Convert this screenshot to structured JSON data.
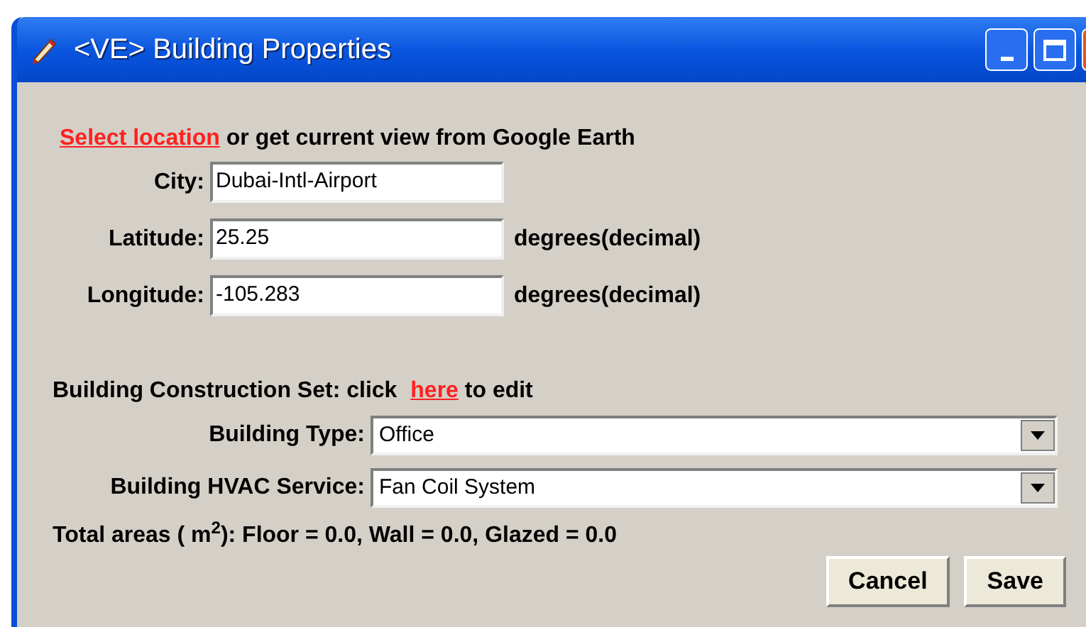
{
  "window": {
    "title": "<VE> Building Properties"
  },
  "location": {
    "link": "Select location",
    "text": "or get current view from Google Earth"
  },
  "fields": [
    {
      "label": "City:",
      "value": "Dubai-Intl-Airport"
    },
    {
      "label": "Latitude:",
      "value": "25.25",
      "unit": "degrees(decimal)"
    },
    {
      "label": "Longitude:",
      "value": "-105.283",
      "unit": "degrees(decimal)"
    }
  ],
  "construction": {
    "before": "Building Construction Set: click",
    "link": "here",
    "after": "to edit"
  },
  "selects": [
    {
      "label": "Building Type:",
      "value": "Office"
    },
    {
      "label": "Building HVAC Service:",
      "value": "Fan Coil System"
    }
  ],
  "totals": "Total areas ( m$^{2}$): Floor = 0.0, Wall = 0.0, Glazed = 0.0",
  "buttons": [
    "Cancel",
    "Save"
  ]
}
